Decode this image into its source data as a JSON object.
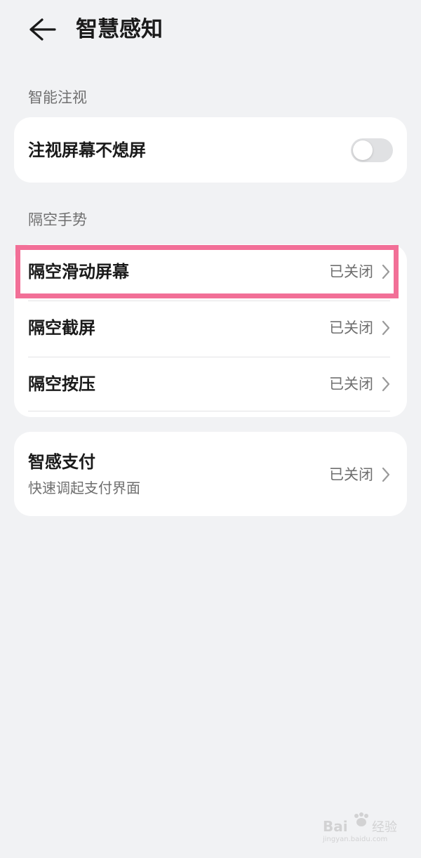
{
  "header": {
    "title": "智慧感知"
  },
  "sections": {
    "gaze_label": "智能注视",
    "air_gesture_label": "隔空手势"
  },
  "gaze_card": {
    "item_label": "注视屏幕不熄屏",
    "toggle_on": false
  },
  "gesture_card": {
    "items": [
      {
        "label": "隔空滑动屏幕",
        "status": "已关闭"
      },
      {
        "label": "隔空截屏",
        "status": "已关闭"
      },
      {
        "label": "隔空按压",
        "status": "已关闭"
      }
    ]
  },
  "pay_card": {
    "label": "智感支付",
    "sub": "快速调起支付界面",
    "status": "已关闭"
  },
  "watermark": {
    "text": "Bai 经验",
    "sub": "jingyan.baidu.com"
  },
  "colors": {
    "background": "#f1f2f4",
    "card": "#ffffff",
    "highlight": "#f26f97",
    "toggle_off": "#e0e1e3"
  }
}
